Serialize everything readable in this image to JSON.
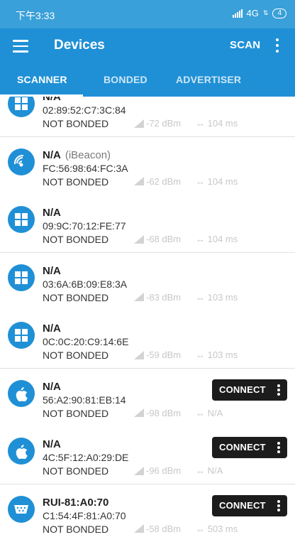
{
  "status": {
    "time": "下午3:33",
    "network": "4G",
    "battery": "4"
  },
  "appbar": {
    "title": "Devices",
    "scan_label": "SCAN"
  },
  "tabs": [
    {
      "label": "SCANNER",
      "active": true
    },
    {
      "label": "BONDED",
      "active": false
    },
    {
      "label": "ADVERTISER",
      "active": false
    }
  ],
  "devices": [
    {
      "name": "N/A",
      "subtype": "",
      "address": "02:89:52:C7:3C:84",
      "bond": "NOT BONDED",
      "rssi": "-72 dBm",
      "interval": "104 ms",
      "icon": "windows-icon",
      "connect": null
    },
    {
      "name": "N/A",
      "subtype": "(iBeacon)",
      "address": "FC:56:98:64:FC:3A",
      "bond": "NOT BONDED",
      "rssi": "-62 dBm",
      "interval": "104 ms",
      "icon": "beacon-icon",
      "connect": null
    },
    {
      "name": "N/A",
      "subtype": "",
      "address": "09:9C:70:12:FE:77",
      "bond": "NOT BONDED",
      "rssi": "-68 dBm",
      "interval": "104 ms",
      "icon": "windows-icon",
      "connect": null
    },
    {
      "name": "N/A",
      "subtype": "",
      "address": "03:6A:6B:09:E8:3A",
      "bond": "NOT BONDED",
      "rssi": "-83 dBm",
      "interval": "103 ms",
      "icon": "windows-icon",
      "connect": null
    },
    {
      "name": "N/A",
      "subtype": "",
      "address": "0C:0C:20:C9:14:6E",
      "bond": "NOT BONDED",
      "rssi": "-59 dBm",
      "interval": "103 ms",
      "icon": "windows-icon",
      "connect": null
    },
    {
      "name": "N/A",
      "subtype": "",
      "address": "56:A2:90:81:EB:14",
      "bond": "NOT BONDED",
      "rssi": "-98 dBm",
      "interval": "N/A",
      "icon": "apple-icon",
      "connect": "CONNECT"
    },
    {
      "name": "N/A",
      "subtype": "",
      "address": "4C:5F:12:A0:29:DE",
      "bond": "NOT BONDED",
      "rssi": "-96 dBm",
      "interval": "N/A",
      "icon": "apple-icon",
      "connect": "CONNECT"
    },
    {
      "name": "RUI-81:A0:70",
      "subtype": "",
      "address": "C1:54:4F:81:A0:70",
      "bond": "NOT BONDED",
      "rssi": "-58 dBm",
      "interval": "503 ms",
      "icon": "serial-port-icon",
      "connect": "CONNECT"
    }
  ]
}
